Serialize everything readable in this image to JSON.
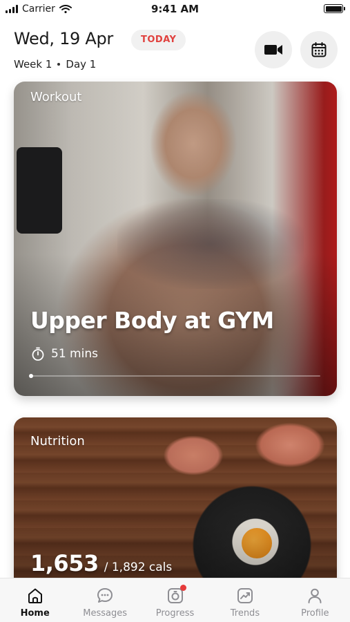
{
  "status_bar": {
    "carrier": "Carrier",
    "time": "9:41 AM",
    "battery_level": 1.0
  },
  "header": {
    "date": "Wed, 19 Apr",
    "today_badge": "TODAY",
    "week": "Week 1",
    "day": "Day 1",
    "video_icon": "video-camera-icon",
    "calendar_icon": "calendar-icon"
  },
  "workout": {
    "label": "Workout",
    "title": "Upper Body at GYM",
    "duration": "51 mins",
    "progress": 0
  },
  "nutrition": {
    "label": "Nutrition",
    "calories_consumed": "1,653",
    "calories_goal": "/ 1,892 cals"
  },
  "tabs": [
    {
      "label": "Home",
      "icon": "home-icon",
      "active": true
    },
    {
      "label": "Messages",
      "icon": "messages-icon",
      "active": false
    },
    {
      "label": "Progress",
      "icon": "progress-icon",
      "active": false,
      "badge": true
    },
    {
      "label": "Trends",
      "icon": "trends-icon",
      "active": false
    },
    {
      "label": "Profile",
      "icon": "profile-icon",
      "active": false
    }
  ],
  "colors": {
    "accent_red": "#e0413e",
    "badge_bg": "#f1f1f1",
    "tab_inactive": "#8e8e93"
  }
}
